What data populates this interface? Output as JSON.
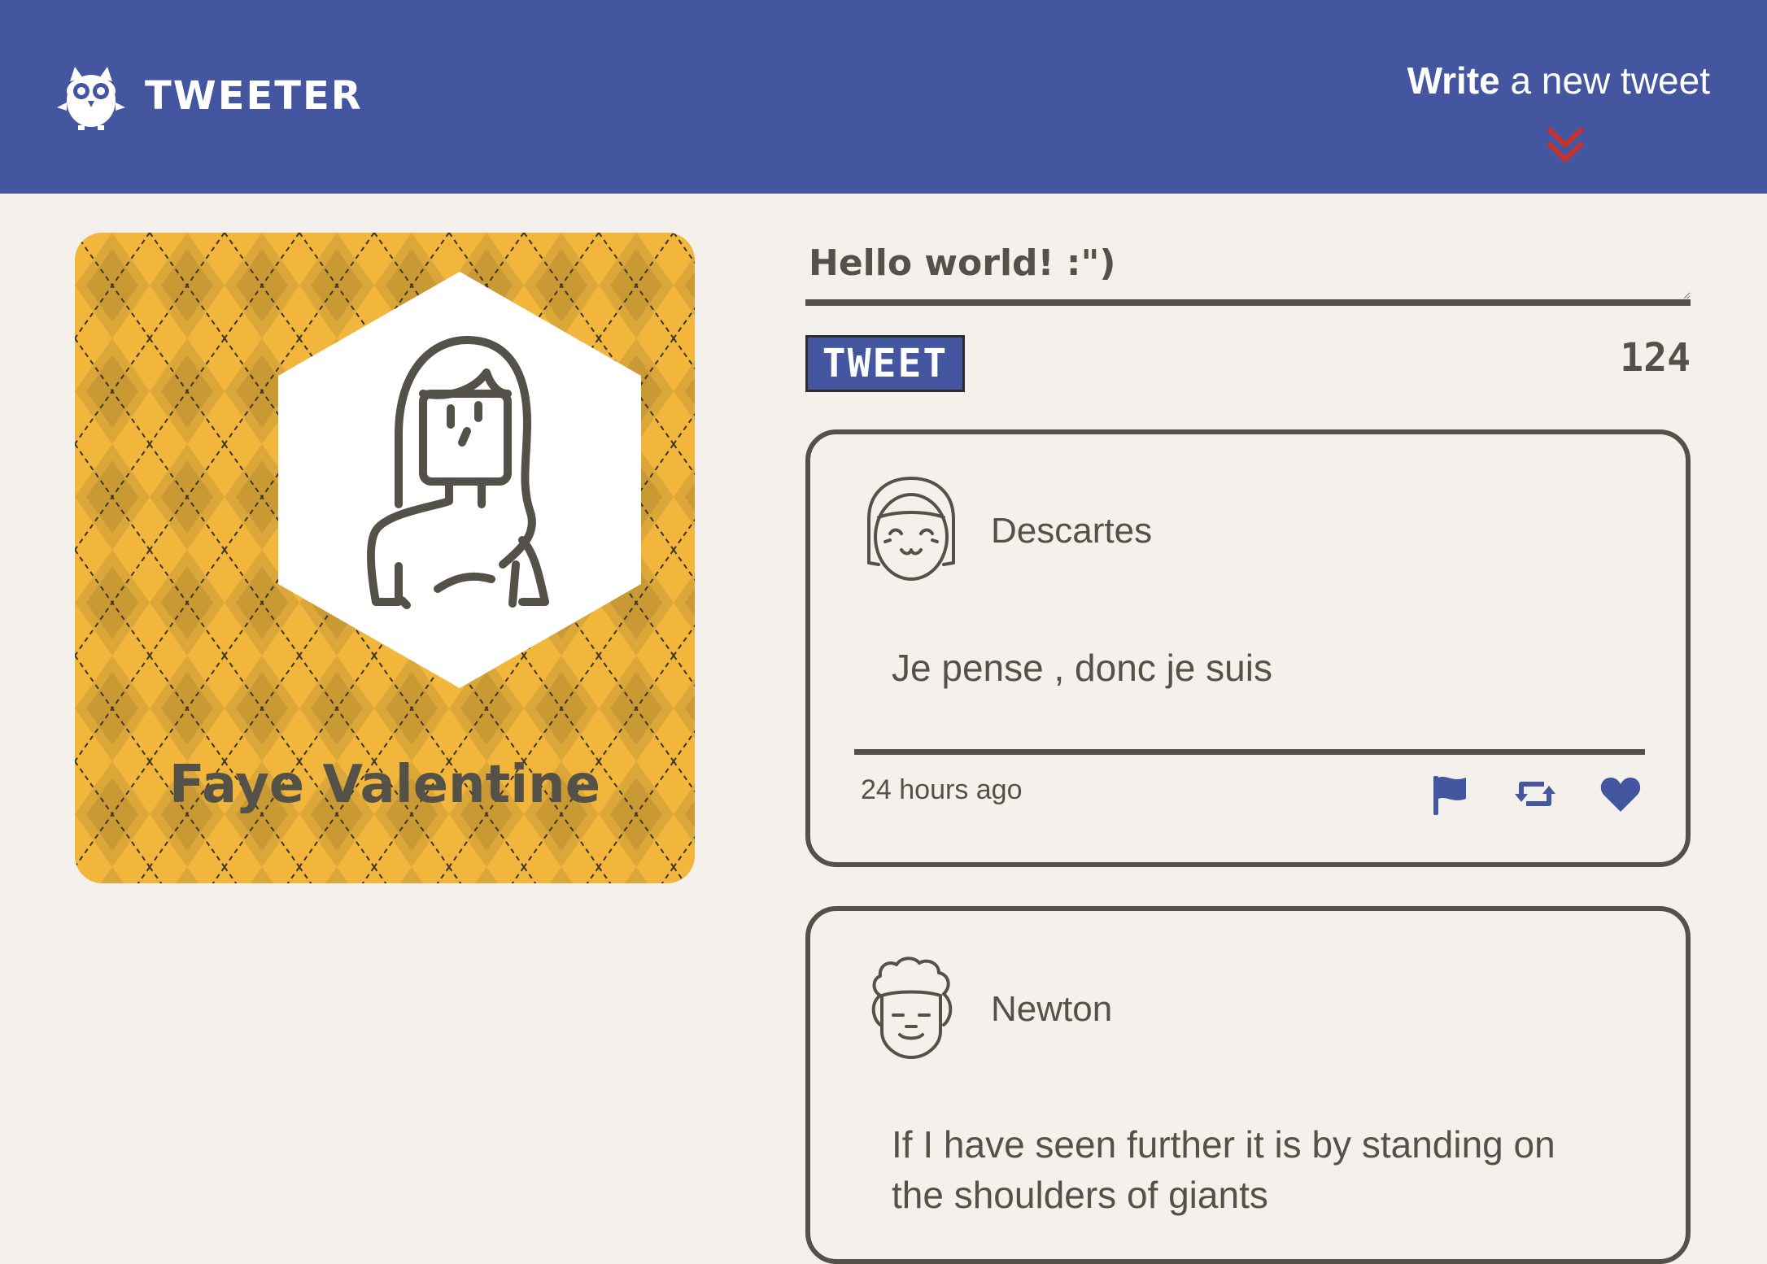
{
  "header": {
    "brand": "TWEETER",
    "compose_toggle_bold": "Write",
    "compose_toggle_rest": " a new tweet",
    "colors": {
      "bar": "#4456a0",
      "chevron": "#c8302b"
    }
  },
  "profile": {
    "name": "Faye Valentine",
    "avatar_icon": "woman-avatar-icon",
    "colors": {
      "card": "#f2b63d",
      "diamond_dark": "#c99a34",
      "diamond_mid": "#dca739"
    }
  },
  "composer": {
    "value": "Hello world! :\")",
    "button_label": "TWEET",
    "remaining_chars": "124"
  },
  "tweets": [
    {
      "author": "Descartes",
      "avatar_icon": "girl-avatar-icon",
      "text": "Je pense , donc je suis",
      "time": "24 hours ago",
      "actions": [
        "flag-icon",
        "retweet-icon",
        "heart-icon"
      ]
    },
    {
      "author": "Newton",
      "avatar_icon": "curly-hair-avatar-icon",
      "text": "If I have seen further it is by standing on the shoulders of giants"
    }
  ],
  "theme": {
    "text": "#545149",
    "background": "#f4f1ec",
    "accent": "#4456a0"
  }
}
